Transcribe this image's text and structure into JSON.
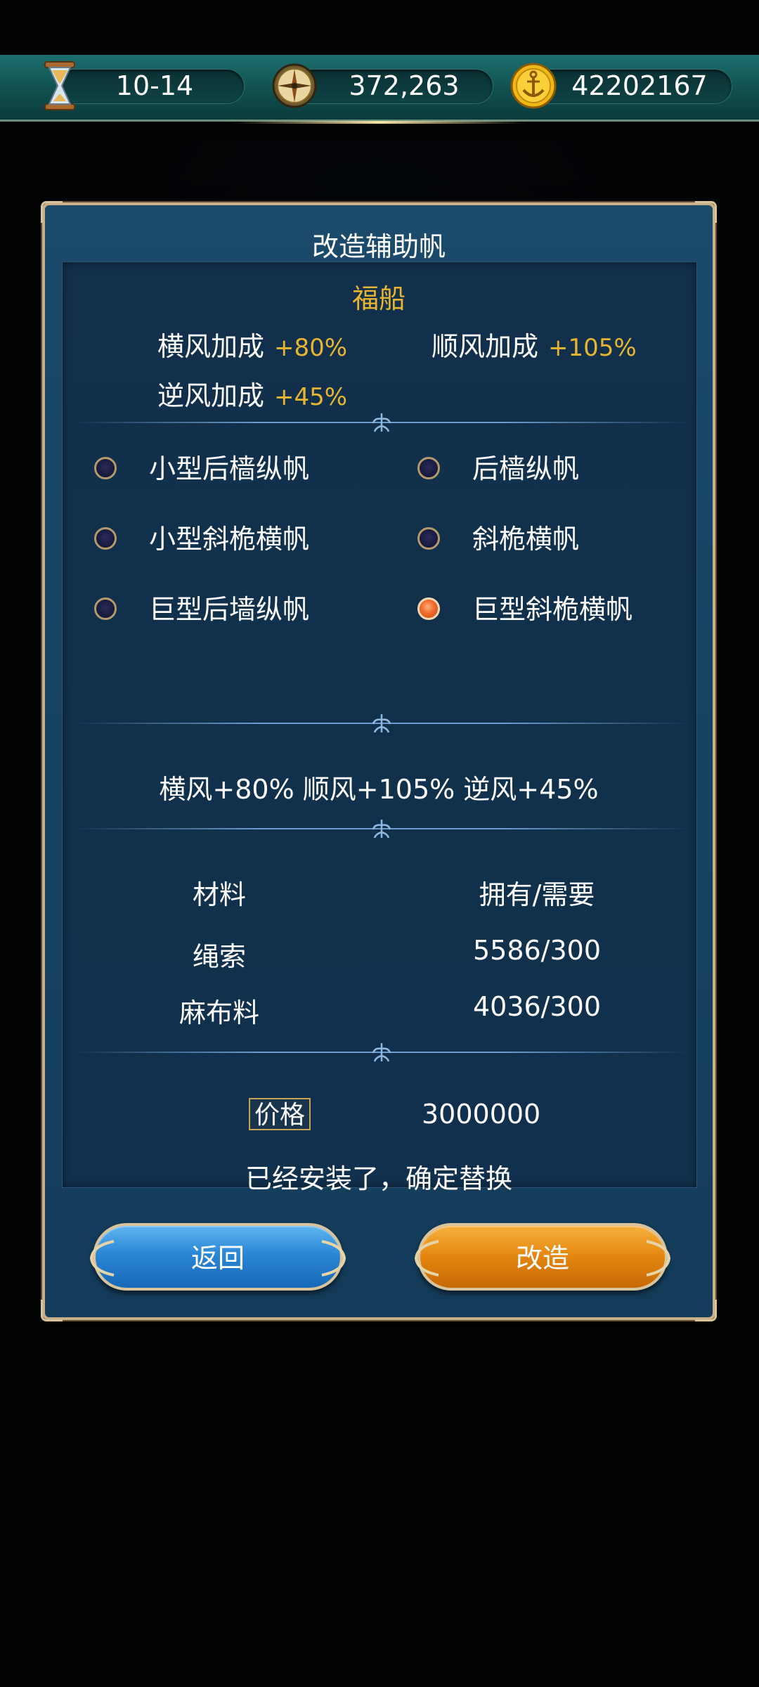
{
  "resources": [
    {
      "icon": "hourglass-icon",
      "value": "10-14"
    },
    {
      "icon": "compass-icon",
      "value": "372,263"
    },
    {
      "icon": "anchor-coin-icon",
      "value": "42202167"
    }
  ],
  "dialog": {
    "title": "改造辅助帆",
    "ship_name": "福船",
    "bonuses": [
      {
        "label": "横风加成",
        "value": "+80%"
      },
      {
        "label": "顺风加成",
        "value": "+105%"
      },
      {
        "label": "逆风加成",
        "value": "+45%"
      }
    ],
    "sail_options": [
      {
        "label": "小型后樯纵帆",
        "selected": false
      },
      {
        "label": "后樯纵帆",
        "selected": false
      },
      {
        "label": "小型斜桅横帆",
        "selected": false
      },
      {
        "label": "斜桅横帆",
        "selected": false
      },
      {
        "label": "巨型后墙纵帆",
        "selected": false
      },
      {
        "label": "巨型斜桅横帆",
        "selected": true
      }
    ],
    "summary": "横风+80%  顺风+105%  逆风+45%",
    "materials": {
      "header_name": "材料",
      "header_qty": "拥有/需要",
      "rows": [
        {
          "name": "绳索",
          "qty": "5586/300"
        },
        {
          "name": "麻布料",
          "qty": "4036/300"
        }
      ]
    },
    "price_label": "价格",
    "price_value": "3000000",
    "notice": "已经安装了，确定替换",
    "back_button": "返回",
    "forge_button": "改造"
  },
  "colors": {
    "accent_gold": "#e8b531",
    "panel_blue": "#143c5a",
    "back_blue": "#2b86d6",
    "forge_orange": "#e3860f"
  }
}
